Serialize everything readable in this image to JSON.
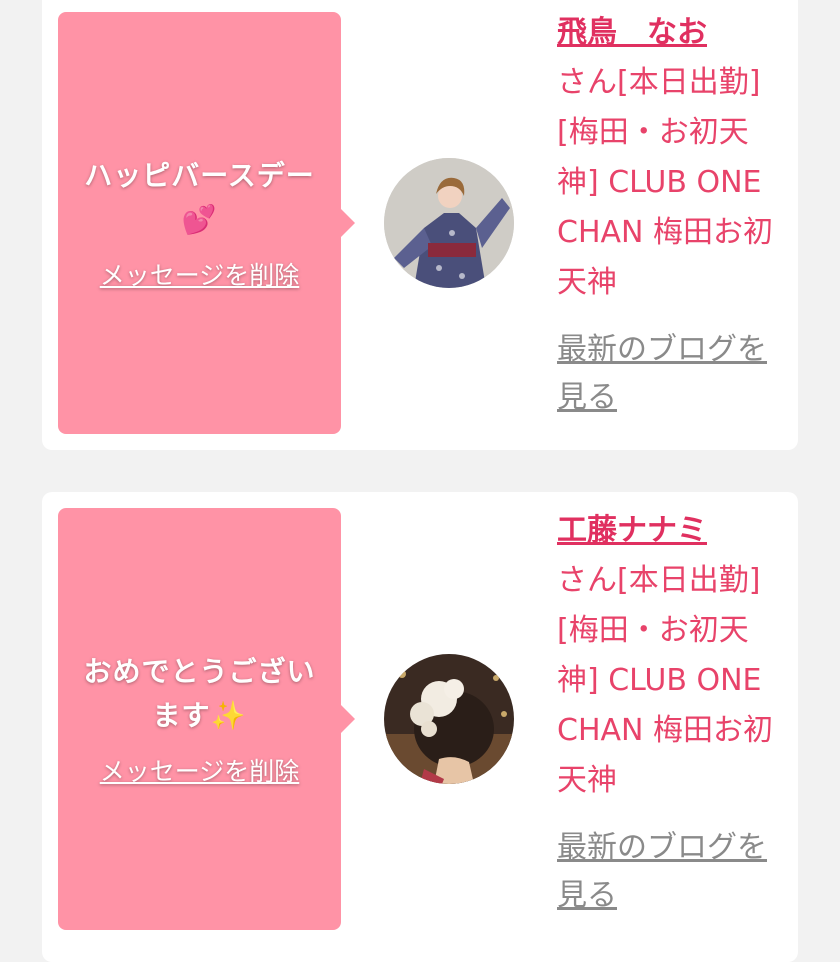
{
  "cards": [
    {
      "message": "ハッピバースデー",
      "emoji": "💕",
      "delete_label": "メッセージを削除",
      "cast_name": "飛鳥　なお",
      "detail": "さん[本日出勤][梅田・お初天神] CLUB ONE CHAN 梅田お初天神",
      "blog_label": "最新のブログを見る"
    },
    {
      "message": "おめでとうございます",
      "emoji": "✨",
      "delete_label": "メッセージを削除",
      "cast_name": "工藤ナナミ",
      "detail": "さん[本日出勤][梅田・お初天神] CLUB ONE CHAN 梅田お初天神",
      "blog_label": "最新のブログを見る"
    }
  ],
  "colors": {
    "bubble": "#ff93a6",
    "accent_text": "#e8436a",
    "muted_link": "#8a8a8a"
  }
}
